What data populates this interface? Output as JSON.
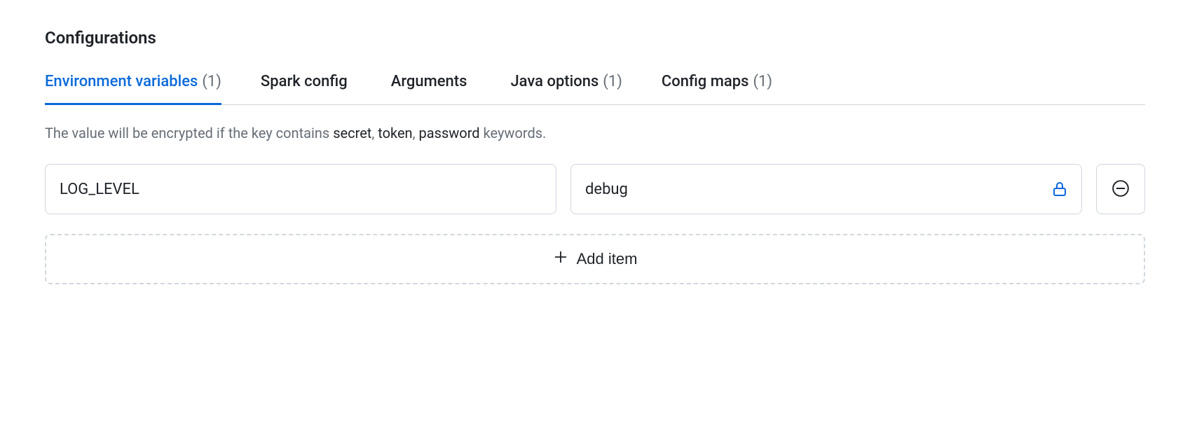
{
  "section": {
    "title": "Configurations"
  },
  "tabs": [
    {
      "label": "Environment variables",
      "count": "(1)"
    },
    {
      "label": "Spark config",
      "count": ""
    },
    {
      "label": "Arguments",
      "count": ""
    },
    {
      "label": "Java options",
      "count": "(1)"
    },
    {
      "label": "Config maps",
      "count": "(1)"
    }
  ],
  "hint": {
    "prefix": "The value will be encrypted if the key contains ",
    "kw1": "secret",
    "sep1": ", ",
    "kw2": "token",
    "sep2": ", ",
    "kw3": "password",
    "suffix": " keywords."
  },
  "env": {
    "rows": [
      {
        "key": "LOG_LEVEL",
        "value": "debug"
      }
    ]
  },
  "actions": {
    "addItem": "Add item"
  }
}
